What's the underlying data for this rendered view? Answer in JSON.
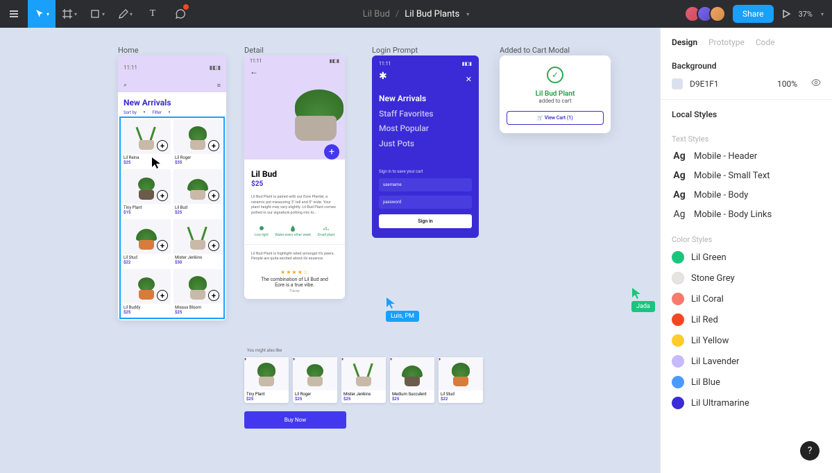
{
  "toolbar": {
    "breadcrumb_inactive": "Lil Bud",
    "breadcrumb_active": "Lil Bud Plants",
    "share": "Share",
    "zoom": "37%"
  },
  "frames": {
    "home": {
      "label": "Home",
      "time": "11:11",
      "heading": "New Arrivals",
      "sort": "Sort by",
      "filter": "Filter",
      "products": [
        {
          "name": "Lil Reina",
          "price": "$25"
        },
        {
          "name": "Lil Roger",
          "price": "$35"
        },
        {
          "name": "Tiny Plant",
          "price": "$15"
        },
        {
          "name": "Lil Bud",
          "price": "$25"
        },
        {
          "name": "Lil Stud",
          "price": "$22"
        },
        {
          "name": "Mister Jenkins",
          "price": "$30"
        },
        {
          "name": "Lil Buddy",
          "price": "$25"
        },
        {
          "name": "Missus Bloom",
          "price": "$25"
        }
      ]
    },
    "detail": {
      "label": "Detail",
      "time": "11:11",
      "title": "Lil Bud",
      "price": "$25",
      "desc": "Lil Bud Plant is paired with our Eore Planter, a ceramic pot measuring 3\" tall and 5\" wide. Your plant height may vary slightly. Lil Bud Plant comes potted in our signature potting mix to…",
      "care": {
        "light": "Low light",
        "water": "Water every other week",
        "size": "Small plant"
      },
      "hr_text": "Lil Bud Plant is highlight rated amongst it's peers. People are quite excited about its essence.",
      "review_quote": "The combination of Lil Bud and Eore is a true vibe.",
      "review_author": "Tracey",
      "ymal_label": "You might also like",
      "ymal": [
        {
          "name": "Tiny Plant",
          "price": "$25"
        },
        {
          "name": "Lil Roger",
          "price": "$25"
        },
        {
          "name": "Mister Jenkins",
          "price": "$25"
        },
        {
          "name": "Medium Succulent",
          "price": "$25"
        },
        {
          "name": "Lil Stud",
          "price": "$22"
        }
      ],
      "buy": "Buy Now"
    },
    "login": {
      "label": "Login Prompt",
      "time": "11:11",
      "links": [
        "New Arrivals",
        "Staff Favorites",
        "Most Popular",
        "Just Pots"
      ],
      "signin_label": "Sign in to save your cart",
      "username": "username",
      "password": "password",
      "signin": "Sign in"
    },
    "modal": {
      "label": "Added to Cart Modal",
      "title": "Lil Bud Plant",
      "sub": "added to cart",
      "btn": "View Cart (1)"
    }
  },
  "cursors": {
    "luis": "Luis, PM",
    "jada": "Jada"
  },
  "inspector": {
    "tabs": {
      "design": "Design",
      "prototype": "Prototype",
      "code": "Code"
    },
    "bg_heading": "Background",
    "bg_value": "D9E1F1",
    "bg_opacity": "100%",
    "local_styles": "Local Styles",
    "text_styles_heading": "Text Styles",
    "text_styles": [
      "Mobile - Header",
      "Mobile - Small Text",
      "Mobile - Body",
      "Mobile - Body Links"
    ],
    "color_styles_heading": "Color Styles",
    "color_styles": [
      {
        "name": "Lil Green",
        "hex": "#1BC47D"
      },
      {
        "name": "Stone Grey",
        "hex": "#E6E4E0"
      },
      {
        "name": "Lil Coral",
        "hex": "#F77A6B"
      },
      {
        "name": "Lil Red",
        "hex": "#F24822"
      },
      {
        "name": "Lil Yellow",
        "hex": "#FFCD29"
      },
      {
        "name": "Lil Lavender",
        "hex": "#C7B9FF"
      },
      {
        "name": "Lil Blue",
        "hex": "#4A9BFF"
      },
      {
        "name": "Lil Ultramarine",
        "hex": "#3A2BD6"
      }
    ]
  }
}
